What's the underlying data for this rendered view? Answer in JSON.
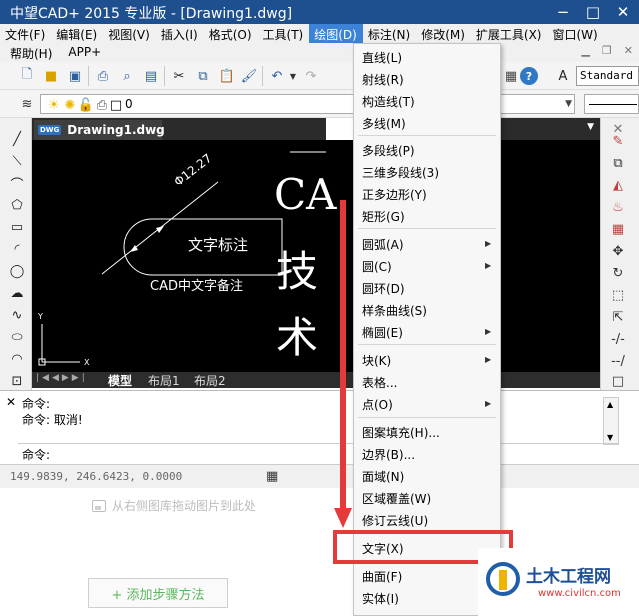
{
  "window": {
    "title": "中望CAD+ 2015 专业版 - [Drawing1.dwg]",
    "buttons": [
      "−",
      "□",
      "✕"
    ]
  },
  "menubar": {
    "items": [
      "文件(F)",
      "编辑(E)",
      "视图(V)",
      "插入(I)",
      "格式(O)",
      "工具(T)",
      "绘图(D)",
      "标注(N)",
      "修改(M)",
      "扩展工具(X)",
      "窗口(W)"
    ],
    "active_index": 6,
    "second_row": [
      "帮助(H)",
      "APP+"
    ]
  },
  "toolbar": {
    "text_style": "Standard"
  },
  "layer_bar": {
    "current_layer": "0"
  },
  "document": {
    "tab_label": "Drawing1.dwg",
    "badge": "DWG"
  },
  "drawing": {
    "dimension_text": "Φ12.27",
    "text_label": "文字标注",
    "note_text": "CAD中文字备注",
    "big_text_1": "CA",
    "big_text_2": "技",
    "big_text_3": "术",
    "axis_x": "X",
    "axis_y": "Y"
  },
  "layout_tabs": [
    "模型",
    "布局1",
    "布局2"
  ],
  "command": {
    "lines": [
      "命令:",
      "命令: 取消!"
    ],
    "prompt": "命令:"
  },
  "status": {
    "coordinates": "149.9839, 246.6423, 0.0000"
  },
  "draw_menu": {
    "items": [
      "直线(L)",
      "射线(R)",
      "构造线(T)",
      "多线(M)",
      "多段线(P)",
      "三维多段线(3)",
      "正多边形(Y)",
      "矩形(G)",
      "圆弧(A)",
      "圆(C)",
      "圆环(D)",
      "样条曲线(S)",
      "椭圆(E)",
      "块(K)",
      "表格...",
      "点(O)",
      "图案填充(H)...",
      "边界(B)...",
      "面域(N)",
      "区域覆盖(W)",
      "修订云线(U)",
      "文字(X)",
      "曲面(F)",
      "实体(I)"
    ]
  },
  "page": {
    "hint": "从右侧图库拖动图片到此处",
    "add_step": "+ 添加步骤方法"
  },
  "watermark": {
    "name": "土木工程网",
    "url": "www.civilcn.com"
  }
}
